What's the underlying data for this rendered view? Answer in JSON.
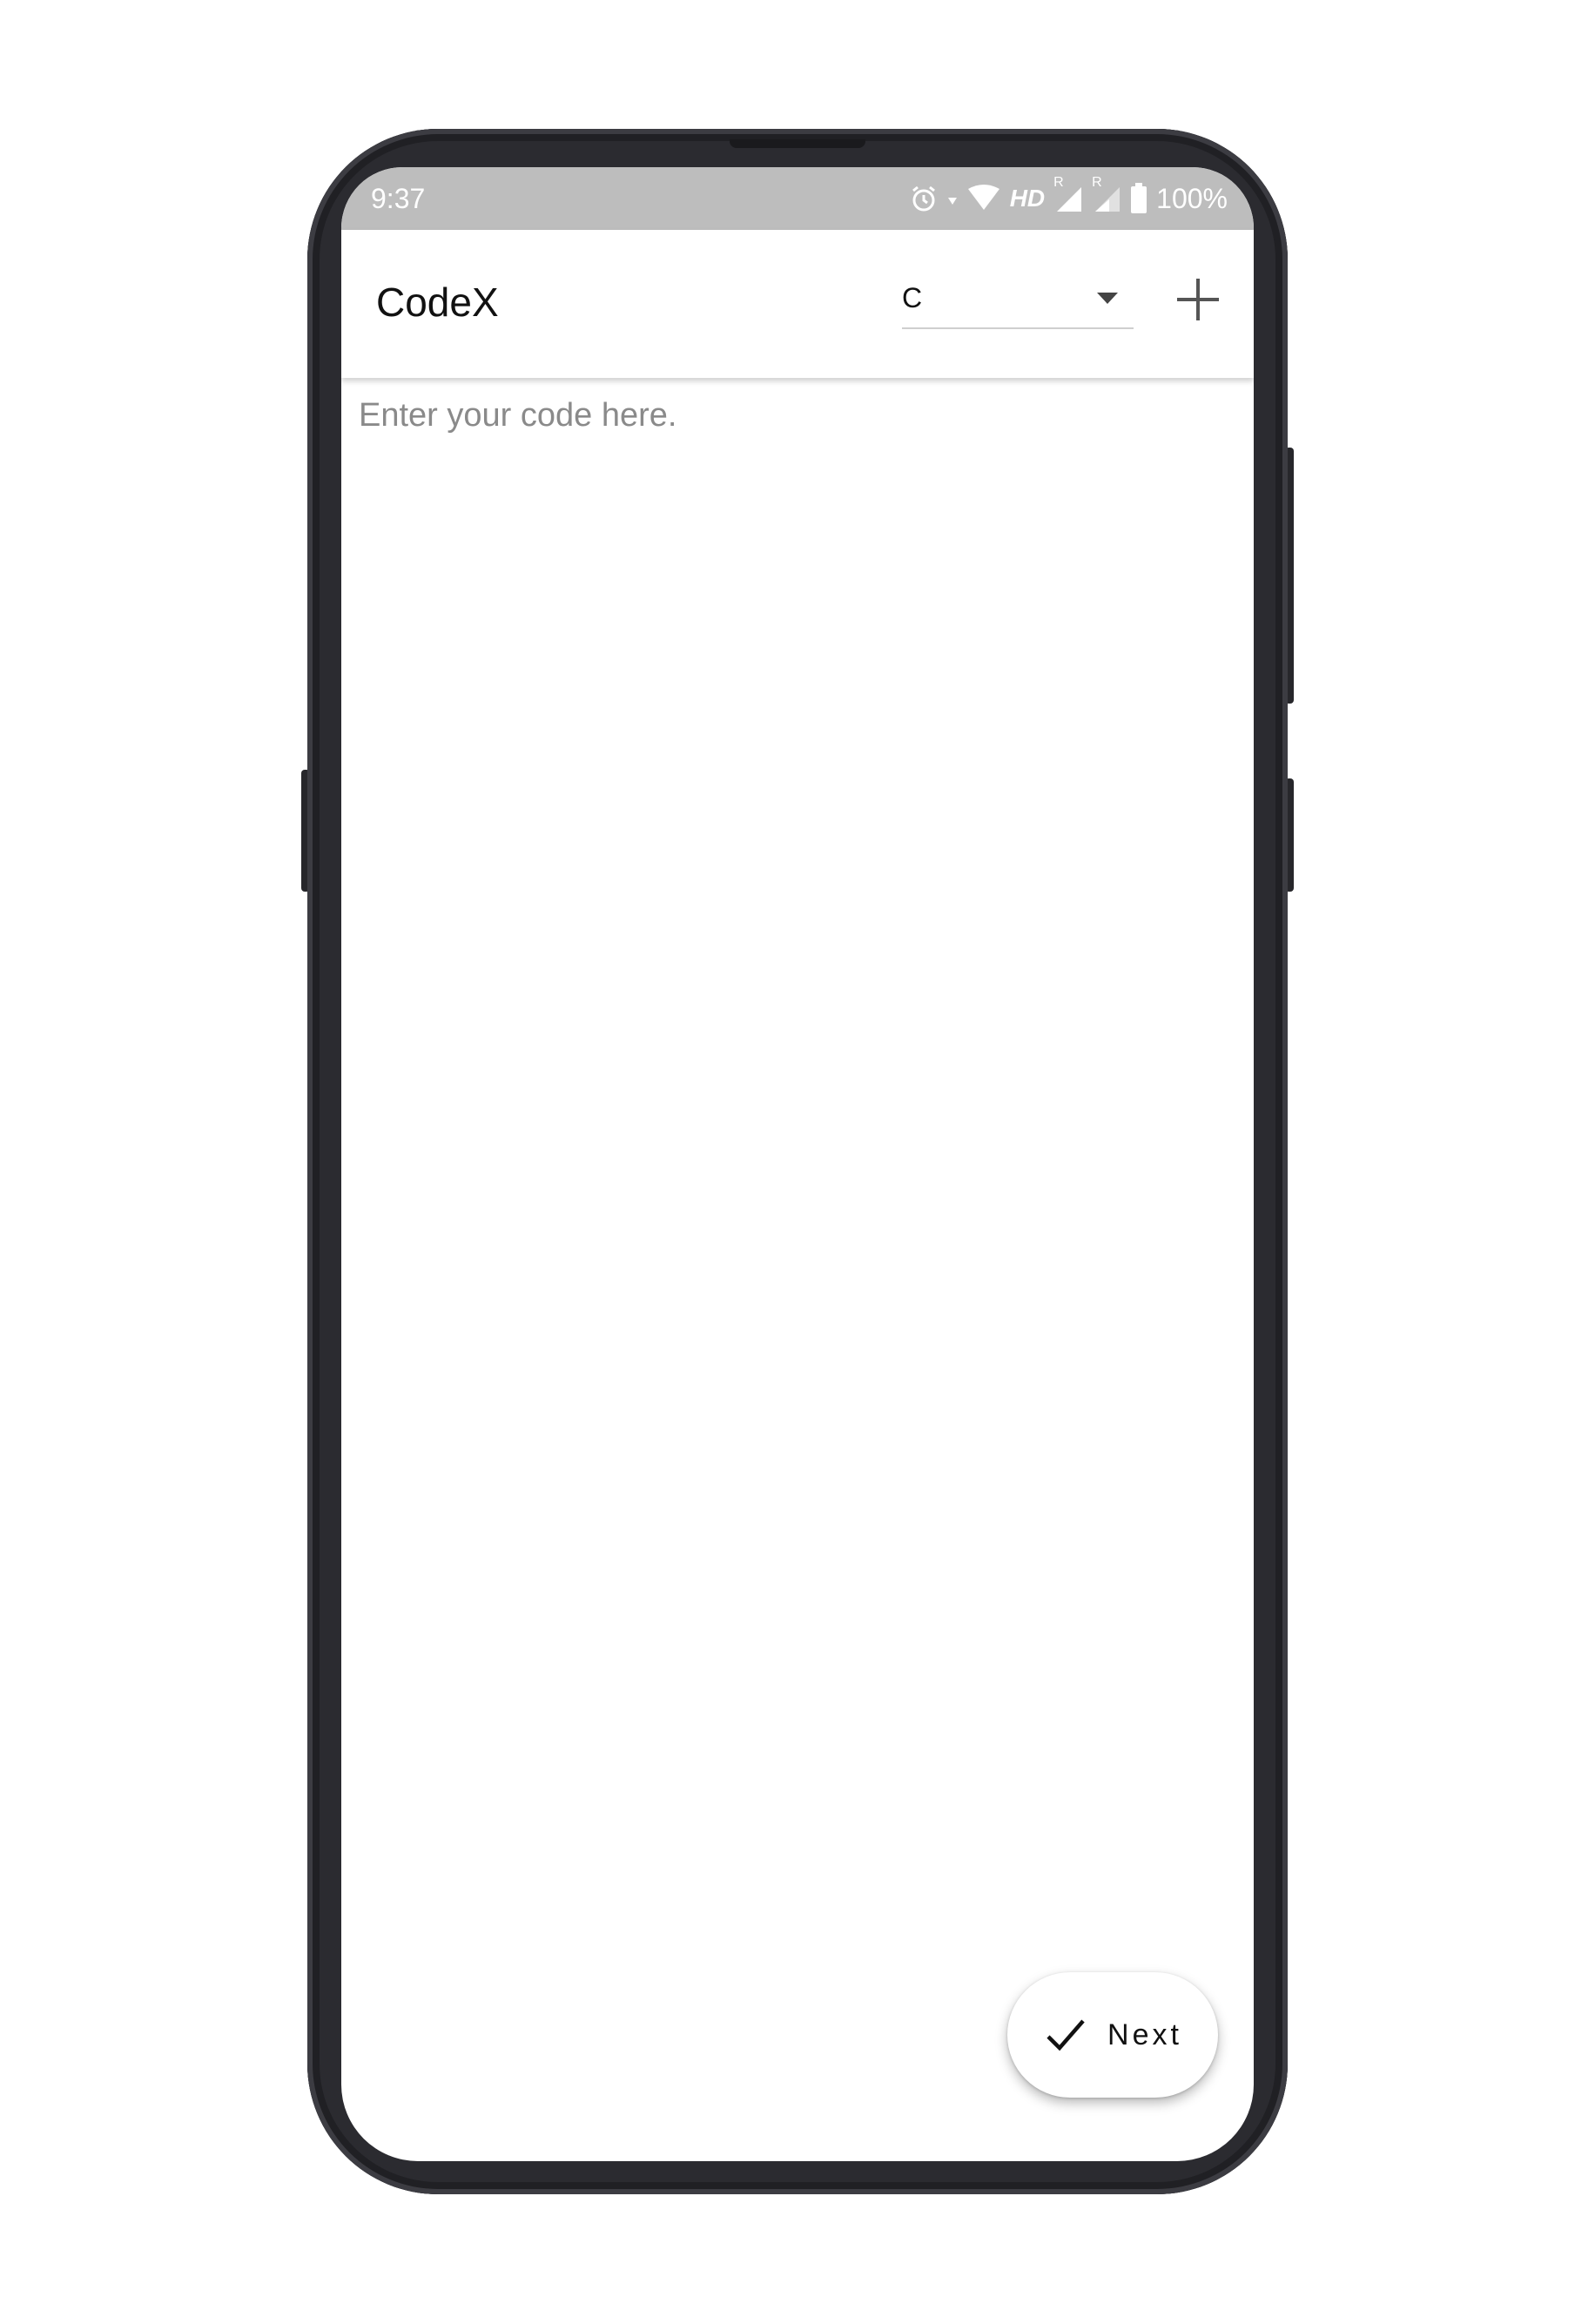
{
  "status_bar": {
    "time": "9:37",
    "network_label": "HD",
    "roaming_1": "R",
    "roaming_2": "R",
    "battery": "100%",
    "icons": [
      "alarm-icon",
      "data-arrow-icon",
      "wifi-icon",
      "signal-icon",
      "signal-icon",
      "battery-icon"
    ]
  },
  "app_bar": {
    "title": "CodeX",
    "language_selected": "C",
    "add_icon": "plus-icon"
  },
  "editor": {
    "placeholder": "Enter your code here.",
    "value": ""
  },
  "fab": {
    "label": "Next",
    "icon": "check-icon"
  },
  "colors": {
    "status_bar": "#bdbdbd",
    "app_bar": "#ffffff",
    "phone_frame": "#2b2b30"
  }
}
